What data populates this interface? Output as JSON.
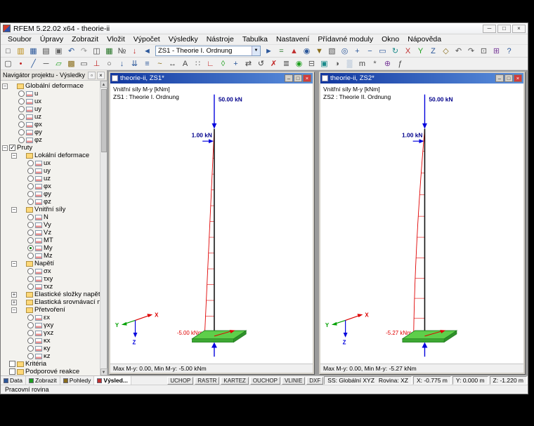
{
  "window": {
    "title": "RFEM 5.22.02 x64 - theorie-ii",
    "controls": {
      "minimize": "─",
      "maximize": "□",
      "close": "×"
    }
  },
  "menu": {
    "items": [
      "Soubor",
      "Úpravy",
      "Zobrazit",
      "Vložit",
      "Výpočet",
      "Výsledky",
      "Nástroje",
      "Tabulka",
      "Nastavení",
      "Přídavné moduly",
      "Okno",
      "Nápověda"
    ]
  },
  "toolbar": {
    "case_selector": "ZS1 - Theorie I. Ordnung",
    "row1_left": [
      {
        "n": "new-document-icon",
        "g": "□",
        "c": "#404040"
      },
      {
        "n": "open-icon",
        "g": "▥",
        "c": "#b8860b"
      },
      {
        "n": "save-icon",
        "g": "▦",
        "c": "#2b579a"
      },
      {
        "n": "print-icon",
        "g": "▤",
        "c": "#444444"
      },
      {
        "n": "copy-icon",
        "g": "▣",
        "c": "#666666"
      },
      {
        "n": "undo-icon",
        "g": "↶",
        "c": "#2b579a"
      },
      {
        "n": "redo-icon",
        "g": "↷",
        "c": "#999999"
      },
      {
        "n": "new-window-icon",
        "g": "◫",
        "c": "#444444"
      },
      {
        "n": "tables-icon",
        "g": "▦",
        "c": "#207020"
      },
      {
        "n": "numbering-icon",
        "g": "№",
        "c": "#444444"
      },
      {
        "n": "loads-icon",
        "g": "↓",
        "c": "#c02020"
      },
      {
        "n": "previous-case-icon",
        "g": "◄",
        "c": "#2b579a"
      }
    ],
    "row1_right": [
      {
        "n": "next-case-icon",
        "g": "►",
        "c": "#2b579a"
      },
      {
        "n": "calculate-icon",
        "g": "=",
        "c": "#207020"
      },
      {
        "n": "show-results-icon",
        "g": "▲",
        "c": "#c03030"
      },
      {
        "n": "show-values-icon",
        "g": "◉",
        "c": "#2b579a"
      },
      {
        "n": "filter-icon",
        "g": "▼",
        "c": "#8a6d1a"
      },
      {
        "n": "panel-icon",
        "g": "▧",
        "c": "#555555"
      },
      {
        "n": "find-icon",
        "g": "◎",
        "c": "#2b579a"
      },
      {
        "n": "zoom-in-icon",
        "g": "+",
        "c": "#2b579a"
      },
      {
        "n": "zoom-out-icon",
        "g": "−",
        "c": "#2b579a"
      },
      {
        "n": "zoom-window-icon",
        "g": "▭",
        "c": "#2b579a"
      },
      {
        "n": "rotate-view-icon",
        "g": "↻",
        "c": "#1a8a8a"
      },
      {
        "n": "view-x-icon",
        "g": "X",
        "c": "#c03030"
      },
      {
        "n": "view-y-icon",
        "g": "Y",
        "c": "#20a020"
      },
      {
        "n": "view-z-icon",
        "g": "Z",
        "c": "#2b579a"
      },
      {
        "n": "isometric-view-icon",
        "g": "◇",
        "c": "#8a6d1a"
      },
      {
        "n": "previous-view-icon",
        "g": "↶",
        "c": "#555555"
      },
      {
        "n": "next-view-icon",
        "g": "↷",
        "c": "#555555"
      },
      {
        "n": "full-screen-icon",
        "g": "⊡",
        "c": "#555555"
      },
      {
        "n": "modules-icon",
        "g": "⊞",
        "c": "#7a3c9a"
      },
      {
        "n": "help-icon",
        "g": "?",
        "c": "#2b579a"
      }
    ],
    "row2": [
      {
        "n": "select-icon",
        "g": "▢",
        "c": "#444444"
      },
      {
        "n": "node-icon",
        "g": "•",
        "c": "#c02020"
      },
      {
        "n": "line-icon",
        "g": "╱",
        "c": "#2b579a"
      },
      {
        "n": "member-icon",
        "g": "─",
        "c": "#444444"
      },
      {
        "n": "surface-icon",
        "g": "▱",
        "c": "#20a020"
      },
      {
        "n": "solid-icon",
        "g": "▩",
        "c": "#8a6d1a"
      },
      {
        "n": "opening-icon",
        "g": "▭",
        "c": "#444444"
      },
      {
        "n": "support-icon",
        "g": "⊥",
        "c": "#c02020"
      },
      {
        "n": "hinge-icon",
        "g": "○",
        "c": "#444444"
      },
      {
        "n": "nodal-load-icon",
        "g": "↓",
        "c": "#2b579a"
      },
      {
        "n": "member-load-icon",
        "g": "⇊",
        "c": "#2b579a"
      },
      {
        "n": "area-load-icon",
        "g": "≡",
        "c": "#2b579a"
      },
      {
        "n": "imperfection-icon",
        "g": "~",
        "c": "#8a6d1a"
      },
      {
        "n": "dimension-icon",
        "g": "↔",
        "c": "#444444"
      },
      {
        "n": "text-icon",
        "g": "A",
        "c": "#444444"
      },
      {
        "n": "grid-icon",
        "g": "∷",
        "c": "#666666"
      },
      {
        "n": "axes-icon",
        "g": "∟",
        "c": "#c02020"
      },
      {
        "n": "work-plane-icon",
        "g": "◊",
        "c": "#20a020"
      },
      {
        "n": "move-icon",
        "g": "+",
        "c": "#2b579a"
      },
      {
        "n": "mirror-icon",
        "g": "⇄",
        "c": "#444444"
      },
      {
        "n": "rotate-icon",
        "g": "↺",
        "c": "#444444"
      },
      {
        "n": "delete-icon",
        "g": "✗",
        "c": "#c02020"
      },
      {
        "n": "layers-icon",
        "g": "≣",
        "c": "#555555"
      },
      {
        "n": "visibility-icon",
        "g": "◉",
        "c": "#20a020"
      },
      {
        "n": "clipping-icon",
        "g": "⊟",
        "c": "#555555"
      },
      {
        "n": "render-icon",
        "g": "▣",
        "c": "#1a8a8a"
      },
      {
        "n": "shading-icon",
        "g": "◑",
        "c": "#555555"
      },
      {
        "n": "background-icon",
        "g": "▒",
        "c": "#7a9ac0"
      },
      {
        "n": "units-icon",
        "g": "m",
        "c": "#444444"
      },
      {
        "n": "settings-icon",
        "g": "*",
        "c": "#555555"
      },
      {
        "n": "generator-icon",
        "g": "⊕",
        "c": "#7a3c9a"
      },
      {
        "n": "formula-icon",
        "g": "ƒ",
        "c": "#444444"
      }
    ]
  },
  "navigator": {
    "title": "Navigátor projektu - Výsledky",
    "pin_glyph": "▫",
    "close_glyph": "×",
    "tree": [
      {
        "v": 0,
        "e": "m",
        "c": "",
        "g": "folder",
        "l": "Globální deformace"
      },
      {
        "v": 1,
        "e": "",
        "c": "r",
        "g": "res",
        "l": "u"
      },
      {
        "v": 1,
        "e": "",
        "c": "r",
        "g": "res",
        "l": "ux"
      },
      {
        "v": 1,
        "e": "",
        "c": "r",
        "g": "res",
        "l": "uy"
      },
      {
        "v": 1,
        "e": "",
        "c": "r",
        "g": "res",
        "l": "uz"
      },
      {
        "v": 1,
        "e": "",
        "c": "r",
        "g": "res",
        "l": "φx"
      },
      {
        "v": 1,
        "e": "",
        "c": "r",
        "g": "res",
        "l": "φy"
      },
      {
        "v": 1,
        "e": "",
        "c": "r",
        "g": "res",
        "l": "φz"
      },
      {
        "v": 0,
        "e": "m",
        "c": "con",
        "g": "",
        "l": "Pruty"
      },
      {
        "v": 1,
        "e": "m",
        "c": "",
        "g": "folder",
        "l": "Lokální deformace"
      },
      {
        "v": 2,
        "e": "",
        "c": "r",
        "g": "res",
        "l": "ux"
      },
      {
        "v": 2,
        "e": "",
        "c": "r",
        "g": "res",
        "l": "uy"
      },
      {
        "v": 2,
        "e": "",
        "c": "r",
        "g": "res",
        "l": "uz"
      },
      {
        "v": 2,
        "e": "",
        "c": "r",
        "g": "res",
        "l": "φx"
      },
      {
        "v": 2,
        "e": "",
        "c": "r",
        "g": "res",
        "l": "φy"
      },
      {
        "v": 2,
        "e": "",
        "c": "r",
        "g": "res",
        "l": "φz"
      },
      {
        "v": 1,
        "e": "m",
        "c": "",
        "g": "folder",
        "l": "Vnitřní síly"
      },
      {
        "v": 2,
        "e": "",
        "c": "r",
        "g": "res",
        "l": "N"
      },
      {
        "v": 2,
        "e": "",
        "c": "r",
        "g": "res",
        "l": "Vy"
      },
      {
        "v": 2,
        "e": "",
        "c": "r",
        "g": "res",
        "l": "Vz"
      },
      {
        "v": 2,
        "e": "",
        "c": "r",
        "g": "res",
        "l": "MT"
      },
      {
        "v": 2,
        "e": "",
        "c": "ron",
        "g": "res",
        "l": "My"
      },
      {
        "v": 2,
        "e": "",
        "c": "r",
        "g": "res",
        "l": "Mz"
      },
      {
        "v": 1,
        "e": "m",
        "c": "",
        "g": "folder",
        "l": "Napětí"
      },
      {
        "v": 2,
        "e": "",
        "c": "r",
        "g": "res",
        "l": "σx"
      },
      {
        "v": 2,
        "e": "",
        "c": "r",
        "g": "res",
        "l": "τxy"
      },
      {
        "v": 2,
        "e": "",
        "c": "r",
        "g": "res",
        "l": "τxz"
      },
      {
        "v": 1,
        "e": "p",
        "c": "",
        "g": "folder",
        "l": "Elastické složky napětí"
      },
      {
        "v": 1,
        "e": "p",
        "c": "",
        "g": "folder",
        "l": "Elastická srovnávací napět"
      },
      {
        "v": 1,
        "e": "m",
        "c": "",
        "g": "folder",
        "l": "Přetvoření"
      },
      {
        "v": 2,
        "e": "",
        "c": "r",
        "g": "res",
        "l": "εx"
      },
      {
        "v": 2,
        "e": "",
        "c": "r",
        "g": "res",
        "l": "γxy"
      },
      {
        "v": 2,
        "e": "",
        "c": "r",
        "g": "res",
        "l": "γxz"
      },
      {
        "v": 2,
        "e": "",
        "c": "r",
        "g": "res",
        "l": "κx"
      },
      {
        "v": 2,
        "e": "",
        "c": "r",
        "g": "res",
        "l": "κy"
      },
      {
        "v": 2,
        "e": "",
        "c": "r",
        "g": "res",
        "l": "κz"
      },
      {
        "v": 0,
        "e": "",
        "c": "coff",
        "g": "folder",
        "l": "Kritéria"
      },
      {
        "v": 0,
        "e": "",
        "c": "coff",
        "g": "folder",
        "l": "Podporové reakce"
      }
    ],
    "tabs": [
      {
        "label": "Data",
        "c": "#2b579a",
        "active": "false"
      },
      {
        "label": "Zobrazit",
        "c": "#20a020",
        "active": "false"
      },
      {
        "label": "Pohledy",
        "c": "#8a6d1a",
        "active": "false"
      },
      {
        "label": "Výsled...",
        "c": "#c03030",
        "active": "true"
      }
    ]
  },
  "mdi_controls": {
    "minimize": "–",
    "maximize": "□",
    "close": "×"
  },
  "viewports": [
    {
      "title": "theorie-ii, ZS1*",
      "legend_line1": "Vnitřní síly M-y [kNm]",
      "legend_line2": "ZS1 : Theorie I. Ordnung",
      "load_top": "50.00 kN",
      "load_side": "1.00 kN",
      "moment_label": "-5.00 kNm",
      "axis_x": "X",
      "axis_y": "Y",
      "axis_z": "Z",
      "status": "Max M-y: 0.00, Min M-y: -5.00 kNm"
    },
    {
      "title": "theorie-ii, ZS2*",
      "legend_line1": "Vnitřní síly M-y [kNm]",
      "legend_line2": "ZS2 : Theorie II. Ordnung",
      "load_top": "50.00 kN",
      "load_side": "1.00 kN",
      "moment_label": "-5.27 kNm",
      "axis_x": "X",
      "axis_y": "Y",
      "axis_z": "Z",
      "status": "Max M-y: 0.00, Min M-y: -5.27 kNm"
    }
  ],
  "statusbar": {
    "hint": "Pracovní rovina",
    "snaps": [
      "UCHOP",
      "RASTR",
      "KARTEZ",
      "OUCHOP",
      "VLINIE",
      "DXF"
    ],
    "cs": "SS: Globální XYZ",
    "plane": "Rovina: XZ",
    "x": "X:  -0.775 m",
    "y": "Y:  0.000 m",
    "z": "Z:  -1.220 m"
  }
}
